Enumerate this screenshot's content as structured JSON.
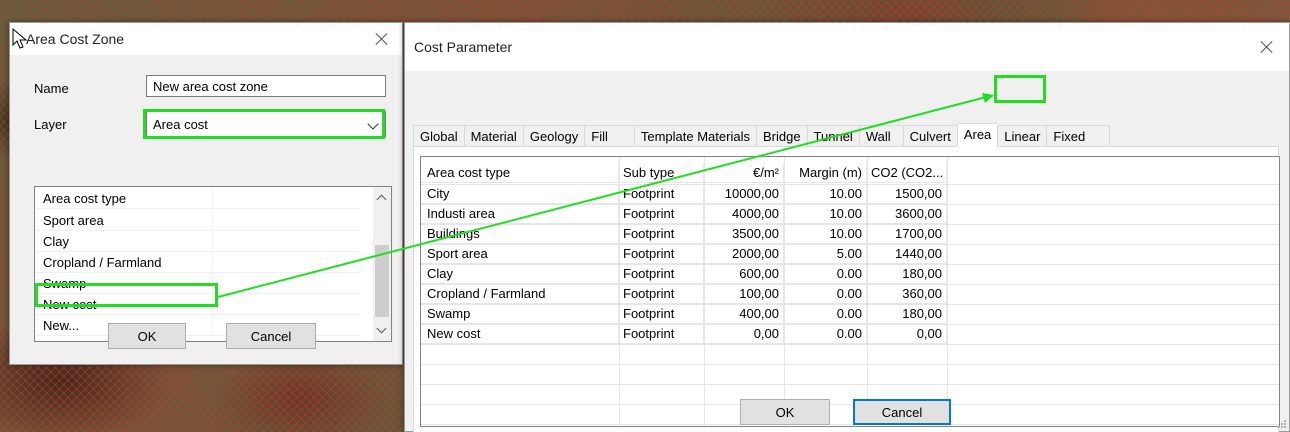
{
  "area_cost_zone": {
    "title": "Area Cost Zone",
    "name_label": "Name",
    "name_value": "New area cost zone",
    "layer_label": "Layer",
    "layer_value": "Area cost",
    "list_items": [
      "Area cost type",
      "Sport area",
      "Clay",
      "Cropland / Farmland",
      "Swamp",
      "New cost",
      "New..."
    ],
    "ok_label": "OK",
    "cancel_label": "Cancel"
  },
  "cost_parameter": {
    "title": "Cost Parameter",
    "tabs": [
      "Global",
      "Material",
      "Geology",
      "Fill",
      "Template Materials",
      "Bridge",
      "Tunnel",
      "Wall",
      "Culvert",
      "Area",
      "Linear",
      "Fixed"
    ],
    "active_tab": "Area",
    "columns": [
      "Area cost type",
      "Sub type",
      "€/m²",
      "Margin (m)",
      "CO2 (CO2..."
    ],
    "rows": [
      [
        "City",
        "Footprint",
        "10000,00",
        "10.00",
        "1500,00"
      ],
      [
        "Industi area",
        "Footprint",
        "4000,00",
        "10.00",
        "3600,00"
      ],
      [
        "Buildings",
        "Footprint",
        "3500,00",
        "10.00",
        "1700,00"
      ],
      [
        "Sport area",
        "Footprint",
        "2000,00",
        "5.00",
        "1440,00"
      ],
      [
        "Clay",
        "Footprint",
        "600,00",
        "0.00",
        "180,00"
      ],
      [
        "Cropland / Farmland",
        "Footprint",
        "100,00",
        "0.00",
        "360,00"
      ],
      [
        "Swamp",
        "Footprint",
        "400,00",
        "0.00",
        "180,00"
      ],
      [
        "New cost",
        "Footprint",
        "0,00",
        "0.00",
        "0,00"
      ]
    ],
    "ok_label": "OK",
    "cancel_label": "Cancel"
  },
  "colors": {
    "highlight": "#22dd22",
    "map_hatch": "#e62828",
    "dialog_bg": "#f0f0f0",
    "default_button_border": "#0078d7"
  }
}
